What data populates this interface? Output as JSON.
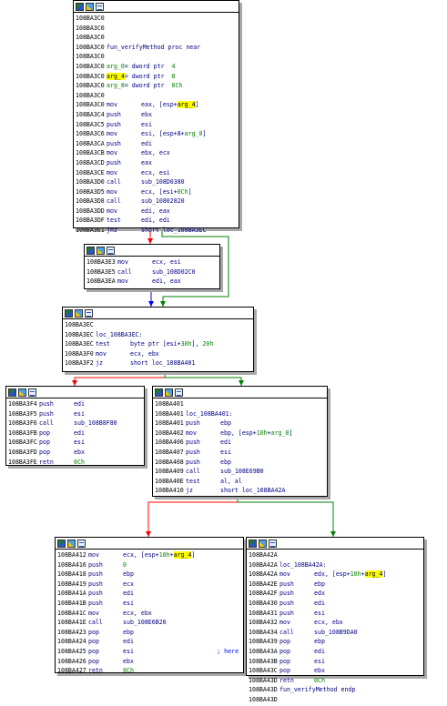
{
  "colors": {
    "edge_true": "#008000",
    "edge_false": "#ff0000",
    "edge_uncond": "#0000ff",
    "highlight": "#ffff00"
  },
  "toolbar_icons": [
    "graph-icon",
    "color-icon",
    "comment-icon"
  ],
  "nodes": [
    {
      "id": "n1",
      "lines": [
        {
          "addr": "108BA3C0",
          "mn": "",
          "op": []
        },
        {
          "addr": "108BA3C0",
          "mn": "",
          "op": []
        },
        {
          "addr": "108BA3C0",
          "mn": "",
          "op": []
        },
        {
          "addr": "108BA3C0",
          "mn": "",
          "op": [
            {
              "t": "fun_verifyMethod proc near"
            }
          ]
        },
        {
          "addr": "108BA3C0",
          "mn": "",
          "op": []
        },
        {
          "addr": "108BA3C0",
          "mn": "",
          "op": [
            {
              "t": "arg_0",
              "c": "num"
            },
            {
              "t": "= dword ptr  "
            },
            {
              "t": "4",
              "c": "num"
            }
          ]
        },
        {
          "addr": "108BA3C0",
          "mn": "",
          "op": [
            {
              "t": "arg_4",
              "c": "hl"
            },
            {
              "t": "= dword ptr  "
            },
            {
              "t": "8",
              "c": "num"
            }
          ]
        },
        {
          "addr": "108BA3C0",
          "mn": "",
          "op": [
            {
              "t": "arg_8",
              "c": "num"
            },
            {
              "t": "= dword ptr  "
            },
            {
              "t": "0Ch",
              "c": "num"
            }
          ]
        },
        {
          "addr": "108BA3C0",
          "mn": "",
          "op": []
        },
        {
          "addr": "108BA3C0",
          "mn": "mov",
          "op": [
            {
              "t": "eax, [esp+"
            },
            {
              "t": "arg_4",
              "c": "hl"
            },
            {
              "t": "]"
            }
          ]
        },
        {
          "addr": "108BA3C4",
          "mn": "push",
          "op": [
            {
              "t": "ebx"
            }
          ]
        },
        {
          "addr": "108BA3C5",
          "mn": "push",
          "op": [
            {
              "t": "esi"
            }
          ]
        },
        {
          "addr": "108BA3C6",
          "mn": "mov",
          "op": [
            {
              "t": "esi, [esp+8+"
            },
            {
              "t": "arg_0",
              "c": "num"
            },
            {
              "t": "]"
            }
          ]
        },
        {
          "addr": "108BA3CA",
          "mn": "push",
          "op": [
            {
              "t": "edi"
            }
          ]
        },
        {
          "addr": "108BA3CB",
          "mn": "mov",
          "op": [
            {
              "t": "ebx, ecx"
            }
          ]
        },
        {
          "addr": "108BA3CD",
          "mn": "push",
          "op": [
            {
              "t": "eax"
            }
          ]
        },
        {
          "addr": "108BA3CE",
          "mn": "mov",
          "op": [
            {
              "t": "ecx, esi"
            }
          ]
        },
        {
          "addr": "108BA3D0",
          "mn": "call",
          "op": [
            {
              "t": "sub_108D0380"
            }
          ]
        },
        {
          "addr": "108BA3D5",
          "mn": "mov",
          "op": [
            {
              "t": "ecx, [esi+"
            },
            {
              "t": "0Ch",
              "c": "num"
            },
            {
              "t": "]"
            }
          ]
        },
        {
          "addr": "108BA3D8",
          "mn": "call",
          "op": [
            {
              "t": "sub_10802820"
            }
          ]
        },
        {
          "addr": "108BA3DD",
          "mn": "mov",
          "op": [
            {
              "t": "edi, eax"
            }
          ]
        },
        {
          "addr": "108BA3DF",
          "mn": "test",
          "op": [
            {
              "t": "edi, edi"
            }
          ]
        },
        {
          "addr": "108BA3E1",
          "mn": "jnz",
          "op": [
            {
              "t": "short loc_108BA3EC"
            }
          ]
        }
      ]
    },
    {
      "id": "n2",
      "lines": [
        {
          "addr": "108BA3E3",
          "mn": "mov",
          "op": [
            {
              "t": "ecx, esi"
            }
          ]
        },
        {
          "addr": "108BA3E5",
          "mn": "call",
          "op": [
            {
              "t": "sub_108D02C0"
            }
          ]
        },
        {
          "addr": "108BA3EA",
          "mn": "mov",
          "op": [
            {
              "t": "edi, eax"
            }
          ]
        }
      ]
    },
    {
      "id": "n3",
      "lines": [
        {
          "addr": "108BA3EC",
          "mn": "",
          "op": []
        },
        {
          "addr": "108BA3EC",
          "mn": "",
          "op": [
            {
              "t": "loc_108BA3EC:"
            }
          ]
        },
        {
          "addr": "108BA3EC",
          "mn": "test",
          "op": [
            {
              "t": "byte ptr [esi+"
            },
            {
              "t": "30h",
              "c": "num"
            },
            {
              "t": "], "
            },
            {
              "t": "20h",
              "c": "num"
            }
          ]
        },
        {
          "addr": "108BA3F0",
          "mn": "mov",
          "op": [
            {
              "t": "ecx, ebx"
            }
          ]
        },
        {
          "addr": "108BA3F2",
          "mn": "jz",
          "op": [
            {
              "t": "short loc_108BA401"
            }
          ]
        }
      ]
    },
    {
      "id": "n4",
      "lines": [
        {
          "addr": "108BA3F4",
          "mn": "push",
          "op": [
            {
              "t": "edi"
            }
          ]
        },
        {
          "addr": "108BA3F5",
          "mn": "push",
          "op": [
            {
              "t": "esi"
            }
          ]
        },
        {
          "addr": "108BA3F6",
          "mn": "call",
          "op": [
            {
              "t": "sub_108B8F80"
            }
          ]
        },
        {
          "addr": "108BA3FB",
          "mn": "pop",
          "op": [
            {
              "t": "edi"
            }
          ]
        },
        {
          "addr": "108BA3FC",
          "mn": "pop",
          "op": [
            {
              "t": "esi"
            }
          ]
        },
        {
          "addr": "108BA3FD",
          "mn": "pop",
          "op": [
            {
              "t": "ebx"
            }
          ]
        },
        {
          "addr": "108BA3FE",
          "mn": "retn",
          "op": [
            {
              "t": "0Ch",
              "c": "num"
            }
          ]
        }
      ]
    },
    {
      "id": "n5",
      "lines": [
        {
          "addr": "108BA401",
          "mn": "",
          "op": []
        },
        {
          "addr": "108BA401",
          "mn": "",
          "op": [
            {
              "t": "loc_108BA401:"
            }
          ]
        },
        {
          "addr": "108BA401",
          "mn": "push",
          "op": [
            {
              "t": "ebp"
            }
          ]
        },
        {
          "addr": "108BA402",
          "mn": "mov",
          "op": [
            {
              "t": "ebp, [esp+"
            },
            {
              "t": "10h",
              "c": "num"
            },
            {
              "t": "+"
            },
            {
              "t": "arg_8",
              "c": "num"
            },
            {
              "t": "]"
            }
          ]
        },
        {
          "addr": "108BA406",
          "mn": "push",
          "op": [
            {
              "t": "edi"
            }
          ]
        },
        {
          "addr": "108BA407",
          "mn": "push",
          "op": [
            {
              "t": "esi"
            }
          ]
        },
        {
          "addr": "108BA408",
          "mn": "push",
          "op": [
            {
              "t": "ebp"
            }
          ]
        },
        {
          "addr": "108BA409",
          "mn": "call",
          "op": [
            {
              "t": "sub_108E69B0"
            }
          ]
        },
        {
          "addr": "108BA40E",
          "mn": "test",
          "op": [
            {
              "t": "al, al"
            }
          ]
        },
        {
          "addr": "108BA410",
          "mn": "jz",
          "op": [
            {
              "t": "short loc_108BA42A"
            }
          ]
        }
      ]
    },
    {
      "id": "n6",
      "lines": [
        {
          "addr": "108BA412",
          "mn": "mov",
          "op": [
            {
              "t": "ecx, [esp+"
            },
            {
              "t": "10h",
              "c": "num"
            },
            {
              "t": "+"
            },
            {
              "t": "arg_4",
              "c": "hl"
            },
            {
              "t": "]"
            }
          ]
        },
        {
          "addr": "108BA416",
          "mn": "push",
          "op": [
            {
              "t": "0",
              "c": "num"
            }
          ]
        },
        {
          "addr": "108BA418",
          "mn": "push",
          "op": [
            {
              "t": "ebp"
            }
          ]
        },
        {
          "addr": "108BA419",
          "mn": "push",
          "op": [
            {
              "t": "ecx"
            }
          ]
        },
        {
          "addr": "108BA41A",
          "mn": "push",
          "op": [
            {
              "t": "edi"
            }
          ]
        },
        {
          "addr": "108BA41B",
          "mn": "push",
          "op": [
            {
              "t": "esi"
            }
          ]
        },
        {
          "addr": "108BA41C",
          "mn": "mov",
          "op": [
            {
              "t": "ecx, ebx"
            }
          ]
        },
        {
          "addr": "108BA41E",
          "mn": "call",
          "op": [
            {
              "t": "sub_108E6B20"
            }
          ]
        },
        {
          "addr": "108BA423",
          "mn": "pop",
          "op": [
            {
              "t": "ebp"
            }
          ]
        },
        {
          "addr": "108BA424",
          "mn": "pop",
          "op": [
            {
              "t": "edi"
            }
          ]
        },
        {
          "addr": "108BA425",
          "mn": "pop",
          "op": [
            {
              "t": "esi                       "
            },
            {
              "t": "; here",
              "c": "cmt"
            }
          ]
        },
        {
          "addr": "108BA426",
          "mn": "pop",
          "op": [
            {
              "t": "ebx"
            }
          ]
        },
        {
          "addr": "108BA427",
          "mn": "retn",
          "op": [
            {
              "t": "0Ch",
              "c": "num"
            }
          ]
        }
      ]
    },
    {
      "id": "n7",
      "lines": [
        {
          "addr": "108BA42A",
          "mn": "",
          "op": []
        },
        {
          "addr": "108BA42A",
          "mn": "",
          "op": [
            {
              "t": "loc_108BA42A:"
            }
          ]
        },
        {
          "addr": "108BA42A",
          "mn": "mov",
          "op": [
            {
              "t": "edx, [esp+"
            },
            {
              "t": "10h",
              "c": "num"
            },
            {
              "t": "+"
            },
            {
              "t": "arg_4",
              "c": "hl"
            },
            {
              "t": "]"
            }
          ]
        },
        {
          "addr": "108BA42E",
          "mn": "push",
          "op": [
            {
              "t": "ebp"
            }
          ]
        },
        {
          "addr": "108BA42F",
          "mn": "push",
          "op": [
            {
              "t": "edx"
            }
          ]
        },
        {
          "addr": "108BA430",
          "mn": "push",
          "op": [
            {
              "t": "edi"
            }
          ]
        },
        {
          "addr": "108BA431",
          "mn": "push",
          "op": [
            {
              "t": "esi"
            }
          ]
        },
        {
          "addr": "108BA432",
          "mn": "mov",
          "op": [
            {
              "t": "ecx, ebx"
            }
          ]
        },
        {
          "addr": "108BA434",
          "mn": "call",
          "op": [
            {
              "t": "sub_108B9DA0"
            }
          ]
        },
        {
          "addr": "108BA439",
          "mn": "pop",
          "op": [
            {
              "t": "ebp"
            }
          ]
        },
        {
          "addr": "108BA43A",
          "mn": "pop",
          "op": [
            {
              "t": "edi"
            }
          ]
        },
        {
          "addr": "108BA43B",
          "mn": "pop",
          "op": [
            {
              "t": "esi"
            }
          ]
        },
        {
          "addr": "108BA43C",
          "mn": "pop",
          "op": [
            {
              "t": "ebx"
            }
          ]
        },
        {
          "addr": "108BA43D",
          "mn": "retn",
          "op": [
            {
              "t": "0Ch",
              "c": "num"
            }
          ]
        },
        {
          "addr": "108BA43D",
          "mn": "",
          "op": [
            {
              "t": "fun_verifyMethod endp"
            }
          ]
        },
        {
          "addr": "108BA43D",
          "mn": "",
          "op": []
        }
      ]
    }
  ],
  "edges": [
    {
      "from": "n1",
      "to": "n2",
      "kind": "false"
    },
    {
      "from": "n1",
      "to": "n3",
      "kind": "true"
    },
    {
      "from": "n2",
      "to": "n3",
      "kind": "uncond"
    },
    {
      "from": "n3",
      "to": "n4",
      "kind": "false"
    },
    {
      "from": "n3",
      "to": "n5",
      "kind": "true"
    },
    {
      "from": "n5",
      "to": "n6",
      "kind": "false"
    },
    {
      "from": "n5",
      "to": "n7",
      "kind": "true"
    }
  ]
}
